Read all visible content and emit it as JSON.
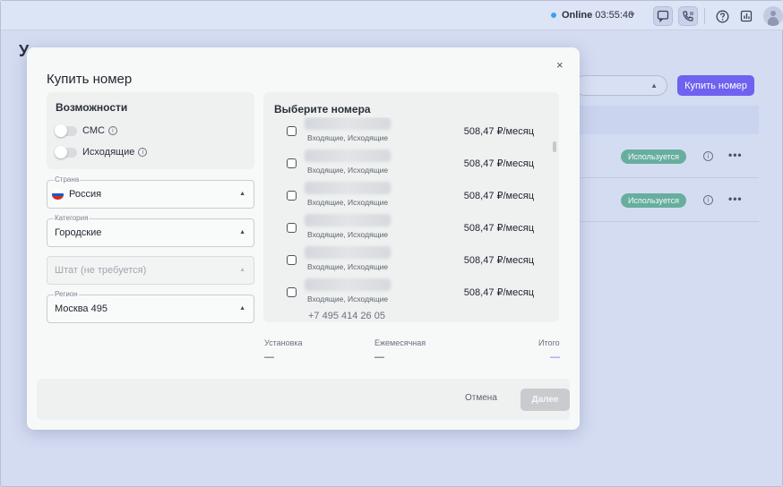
{
  "topbar": {
    "status_label": "Online",
    "status_time": "03:55:46",
    "chat_icon": "chat-icon",
    "phone_icon": "phone-icon",
    "help_icon": "help-icon",
    "stats_icon": "stats-icon",
    "avatar_icon": "avatar-icon",
    "accent": "#3aa0f5"
  },
  "background": {
    "page_title_partial": "У",
    "buy_button": "Купить номер",
    "rows": [
      {
        "badge": "Используется"
      },
      {
        "badge": "Используется"
      }
    ]
  },
  "modal": {
    "title": "Купить номер",
    "close_glyph": "×",
    "capabilities": {
      "caption": "Возможности",
      "sms_label": "СМС",
      "outgoing_label": "Исходящие",
      "info_glyph": "i"
    },
    "country": {
      "legend": "Страна",
      "value": "Россия"
    },
    "category": {
      "legend": "Категория",
      "value": "Городские"
    },
    "state": {
      "placeholder": "Штат (не требуется)"
    },
    "region": {
      "legend": "Регион",
      "value": "Москва 495"
    },
    "numbers": {
      "caption": "Выберите номера",
      "items": [
        {
          "type": "Входящие, Исходящие",
          "price": "508,47 ₽/месяц"
        },
        {
          "type": "Входящие, Исходящие",
          "price": "508,47 ₽/месяц"
        },
        {
          "type": "Входящие, Исходящие",
          "price": "508,47 ₽/месяц"
        },
        {
          "type": "Входящие, Исходящие",
          "price": "508,47 ₽/месяц"
        },
        {
          "type": "Входящие, Исходящие",
          "price": "508,47 ₽/месяц"
        },
        {
          "type": "Входящие, Исходящие",
          "price": "508,47 ₽/месяц"
        }
      ],
      "partial_number": "+7 495 414 26 05"
    },
    "summary": {
      "setup_label": "Установка",
      "setup_value": "—",
      "monthly_label": "Ежемесячная",
      "monthly_value": "—",
      "total_label": "Итого",
      "total_value": "—"
    },
    "footer": {
      "cancel": "Отмена",
      "next": "Далее"
    }
  },
  "colors": {
    "primary": "#6f62f0",
    "badge": "#68ae9e"
  }
}
